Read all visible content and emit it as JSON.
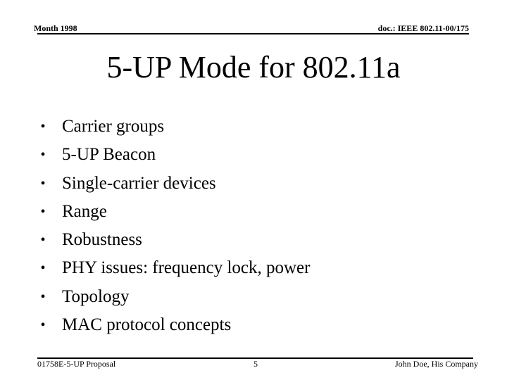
{
  "header": {
    "date": "Month 1998",
    "doc_id": "doc.: IEEE 802.11-00/175"
  },
  "slide": {
    "title": "5-UP Mode for 802.11a",
    "bullet_glyph": "•",
    "bullets": [
      "Carrier groups",
      "5-UP Beacon",
      "Single-carrier devices",
      "Range",
      "Robustness",
      "PHY issues: frequency lock, power",
      "Topology",
      "MAC protocol concepts"
    ]
  },
  "footer": {
    "document_name": "01758E-5-UP Proposal",
    "page_number": "5",
    "author": "John Doe, His Company"
  }
}
